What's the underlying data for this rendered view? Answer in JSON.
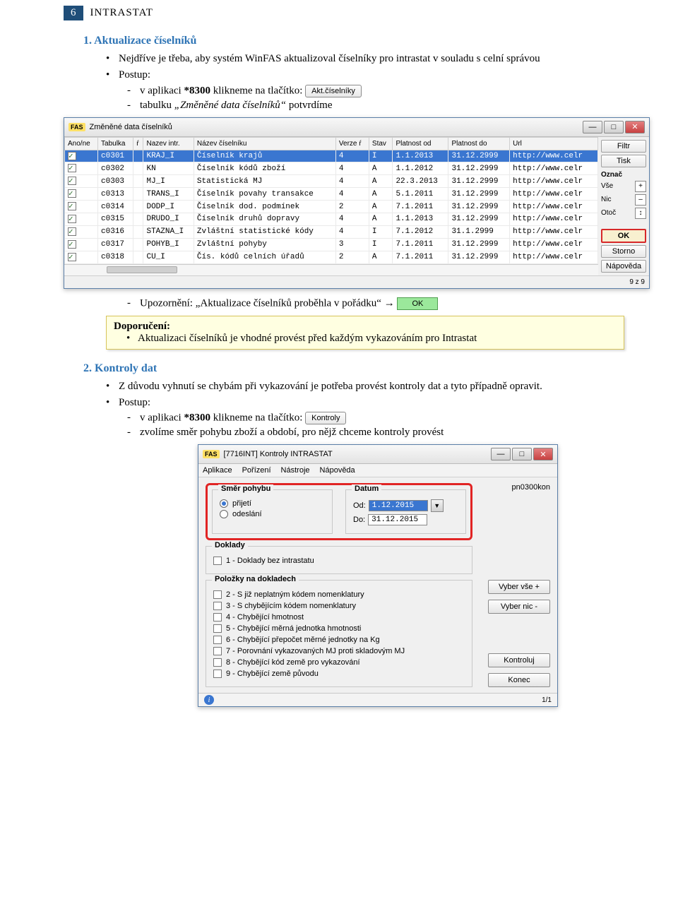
{
  "header": {
    "page_num": "6",
    "title": "INTRASTAT"
  },
  "sec1": {
    "heading": "1. Aktualizace číselníků",
    "b1": "Nejdříve je třeba, aby systém WinFAS aktualizoval číselníky pro intrastat v souladu s celní správou",
    "postup": "Postup:",
    "l1a": "v aplikaci ",
    "l1b": "*8300",
    "l1c": " klikneme na tlačítko: ",
    "btn_akt": "Akt.číselníky",
    "l2a": "tabulku ",
    "l2b": "„Změněné data číselníků“",
    "l2c": " potvrdíme"
  },
  "win1": {
    "title": "Změněné data číselníků",
    "cols": [
      "Ano/ne",
      "Tabulka",
      "ŕ",
      "Nazev intr.",
      "Název číselníku",
      "Verze ŕ",
      "Stav",
      "Platnost od",
      "Platnost do",
      "Url"
    ],
    "rows": [
      {
        "sel": true,
        "code": "c0301",
        "intr": "KRAJ_I",
        "name": "Číselník krajů",
        "ver": "4",
        "st": "I",
        "od": "1.1.2013",
        "do": "31.12.2999",
        "url": "http://www.celr"
      },
      {
        "sel": false,
        "code": "c0302",
        "intr": "KN",
        "name": "Číselník kódů zboží",
        "ver": "4",
        "st": "A",
        "od": "1.1.2012",
        "do": "31.12.2999",
        "url": "http://www.celr"
      },
      {
        "sel": false,
        "code": "c0303",
        "intr": "MJ_I",
        "name": "Statistická MJ",
        "ver": "4",
        "st": "A",
        "od": "22.3.2013",
        "do": "31.12.2999",
        "url": "http://www.celr"
      },
      {
        "sel": false,
        "code": "c0313",
        "intr": "TRANS_I",
        "name": "Číselník povahy transakce",
        "ver": "4",
        "st": "A",
        "od": "5.1.2011",
        "do": "31.12.2999",
        "url": "http://www.celr"
      },
      {
        "sel": false,
        "code": "c0314",
        "intr": "DODP_I",
        "name": "Číselník dod. podmínek",
        "ver": "2",
        "st": "A",
        "od": "7.1.2011",
        "do": "31.12.2999",
        "url": "http://www.celr"
      },
      {
        "sel": false,
        "code": "c0315",
        "intr": "DRUDO_I",
        "name": "Číselník druhů dopravy",
        "ver": "4",
        "st": "A",
        "od": "1.1.2013",
        "do": "31.12.2999",
        "url": "http://www.celr"
      },
      {
        "sel": false,
        "code": "c0316",
        "intr": "STAZNA_I",
        "name": "Zvláštní statistické kódy",
        "ver": "4",
        "st": "I",
        "od": "7.1.2012",
        "do": "31.1.2999",
        "url": "http://www.celr"
      },
      {
        "sel": false,
        "code": "c0317",
        "intr": "POHYB_I",
        "name": "Zvláštní pohyby",
        "ver": "3",
        "st": "I",
        "od": "7.1.2011",
        "do": "31.12.2999",
        "url": "http://www.celr"
      },
      {
        "sel": false,
        "code": "c0318",
        "intr": "CU_I",
        "name": "Čís. kódů celních úřadů",
        "ver": "2",
        "st": "A",
        "od": "7.1.2011",
        "do": "31.12.2999",
        "url": "http://www.celr"
      }
    ],
    "side": {
      "filtr": "Filtr",
      "tisk": "Tisk",
      "oznac": "Označ",
      "vse": "Vše",
      "plus": "+",
      "nic": "Nic",
      "minus": "–",
      "otoc": "Otoč",
      "sw": "↕",
      "ok": "OK",
      "storno": "Storno",
      "napoveda": "Nápověda"
    },
    "count": "9 z 9"
  },
  "upoz": {
    "pre": "Upozornění: „Aktualizace číselníků proběhla v pořádku“ ",
    "arrow": "→",
    "ok": "OK"
  },
  "recbox": {
    "title": "Doporučení:",
    "item": "Aktualizaci číselníků je vhodné provést před každým vykazováním pro Intrastat"
  },
  "sec2": {
    "heading": "2. Kontroly dat",
    "b1": "Z důvodu vyhnutí se chybám při vykazování je potřeba provést kontroly dat a tyto případně opravit.",
    "postup": "Postup:",
    "l1a": "v aplikaci ",
    "l1b": "*8300",
    "l1c": " klikneme na tlačítko: ",
    "btn_k": "Kontroly",
    "l2": "zvolíme směr pohybu zboží a období, pro nějž chceme kontroly provést"
  },
  "win2": {
    "title": "[7716INT] Kontroly INTRASTAT",
    "menu": [
      "Aplikace",
      "Pořízení",
      "Nástroje",
      "Nápověda"
    ],
    "pn": "pn0300kon",
    "grp_smer": "Směr pohybu",
    "opt_prijeti": "přijetí",
    "opt_odeslani": "odeslání",
    "grp_datum": "Datum",
    "od_lbl": "Od:",
    "do_lbl": "Do:",
    "od_val": "1.12.2015",
    "do_val": "31.12.2015",
    "grp_doklady": "Doklady",
    "doklady_item": "1 - Doklady bez intrastatu",
    "grp_polozky": "Položky na dokladech",
    "polozky": [
      "2 - S již neplatným kódem nomenklatury",
      "3 - S chybějícím kódem nomenklatury",
      "4 - Chybějící hmotnost",
      "5 - Chybějící měrná jednotka hmotnosti",
      "6 - Chybějící přepočet měrné jednotky na Kg",
      "7 - Porovnání vykazovaných MJ proti skladovým MJ",
      "8 - Chybějící kód země pro vykazování",
      "9 - Chybějící země původu"
    ],
    "btn_vse": "Vyber vše +",
    "btn_nic": "Vyber nic -",
    "btn_kontroluj": "Kontroluj",
    "btn_konec": "Konec",
    "pager": "1/1"
  }
}
